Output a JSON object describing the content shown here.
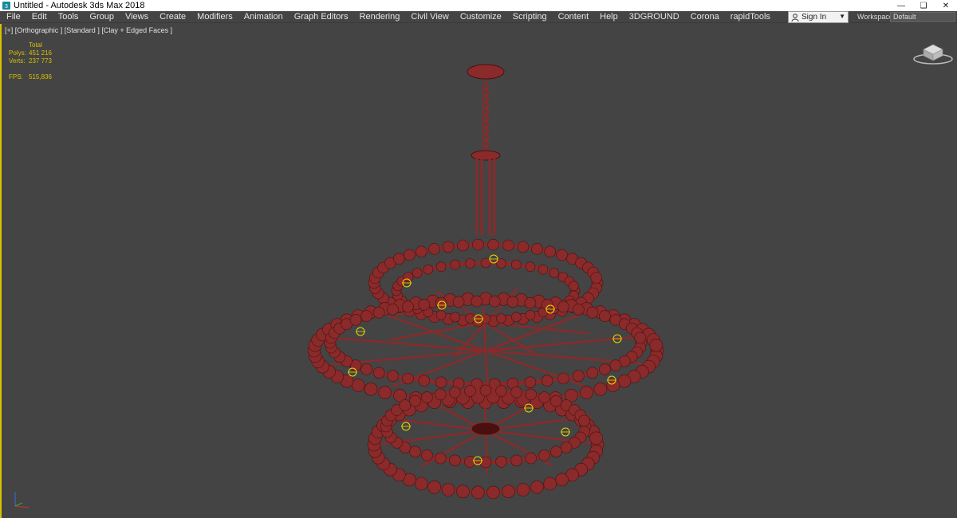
{
  "window": {
    "title": "Untitled - Autodesk 3ds Max 2018",
    "app_icon": "3ds-max-icon",
    "controls": [
      "minimize-icon",
      "restore-icon",
      "close-icon"
    ]
  },
  "menu": {
    "items": [
      "File",
      "Edit",
      "Tools",
      "Group",
      "Views",
      "Create",
      "Modifiers",
      "Animation",
      "Graph Editors",
      "Rendering",
      "Civil View",
      "Customize",
      "Scripting",
      "Content",
      "Help",
      "3DGROUND",
      "Corona",
      "rapidTools"
    ]
  },
  "account": {
    "signin_label": "Sign In",
    "icon": "user-icon"
  },
  "workspaces": {
    "label": "Workspaces:",
    "value": "Default"
  },
  "viewport": {
    "label": "[+] [Orthographic ] [Standard ] [Clay + Edged Faces ]",
    "stats": {
      "header": "Total",
      "polys_label": "Polys:",
      "polys_value": "451 216",
      "verts_label": "Verts:",
      "verts_value": "237 773",
      "fps_label": "FPS:",
      "fps_value": "515,836"
    },
    "model_color": "#8a2a2a",
    "light_color": "#e8d800",
    "border_color": "#d8c200"
  }
}
